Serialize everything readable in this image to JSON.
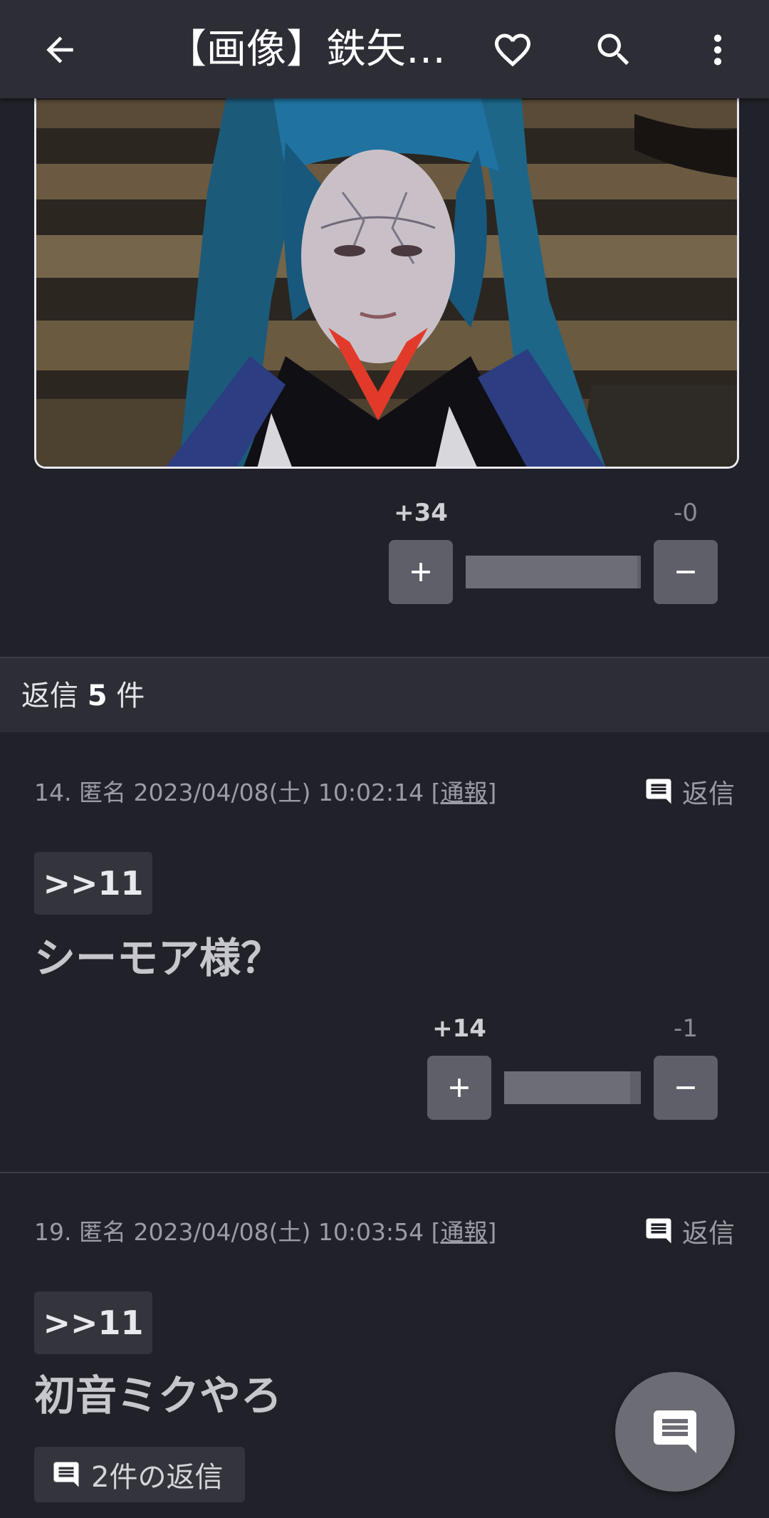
{
  "appbar": {
    "title": "【画像】鉄矢…"
  },
  "post": {
    "votes": {
      "plus": "+34",
      "minus": "-0",
      "plus_ratio": 0.98
    }
  },
  "replies": {
    "label_prefix": "返信",
    "count": "5",
    "label_suffix": "件"
  },
  "comments": [
    {
      "meta": "14. 匿名 2023/04/08(土) 10:02:14 [",
      "report": "通報",
      "meta_end": "]",
      "reply_label": "返信",
      "anchor": ">>11",
      "body": "シーモア様？",
      "votes": {
        "plus": "+14",
        "minus": "-1",
        "plus_ratio": 0.92
      }
    },
    {
      "meta": "19. 匿名 2023/04/08(土) 10:03:54 [",
      "report": "通報",
      "meta_end": "]",
      "reply_label": "返信",
      "anchor": ">>11",
      "body": "初音ミクやろ",
      "replies_chip": "2件の返信"
    }
  ],
  "colors": {
    "background": "#21212a",
    "appbar": "#2d2d36",
    "button": "#5f5f69",
    "fab": "#6c6c75"
  }
}
